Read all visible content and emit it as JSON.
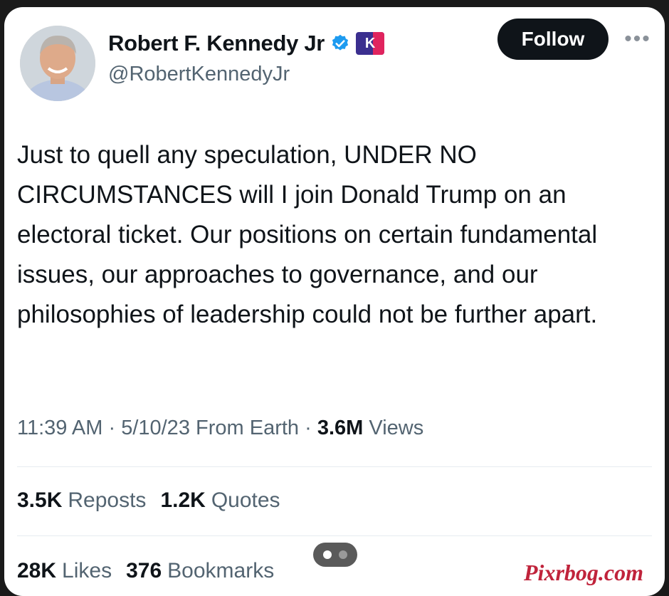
{
  "author": {
    "name": "Robert F. Kennedy Jr",
    "handle": "@RobertKennedyJr",
    "verified_icon": "verified-badge-icon",
    "affiliate_badge": "K"
  },
  "actions": {
    "follow_label": "Follow",
    "more_label": "•••"
  },
  "tweet": {
    "text": "Just to quell any speculation, UNDER NO CIRCUMSTANCES will I join Donald Trump on an electoral ticket. Our positions on certain fundamental issues, our approaches to governance, and our philosophies of leadership could not be further apart."
  },
  "meta": {
    "time": "11:39 AM",
    "separator": "·",
    "date": "5/10/23",
    "source": "From Earth",
    "views_count": "3.6M",
    "views_label": "Views"
  },
  "stats_row1": [
    {
      "count": "3.5K",
      "label": "Reposts"
    },
    {
      "count": "1.2K",
      "label": "Quotes"
    }
  ],
  "stats_row2": [
    {
      "count": "28K",
      "label": "Likes"
    },
    {
      "count": "376",
      "label": "Bookmarks"
    }
  ],
  "watermark": "Pixrbog.com",
  "colors": {
    "accent_verified": "#1d9bf0",
    "text_primary": "#0f1419",
    "text_secondary": "#536471",
    "button_bg": "#0f1419",
    "watermark": "#c0233b"
  }
}
